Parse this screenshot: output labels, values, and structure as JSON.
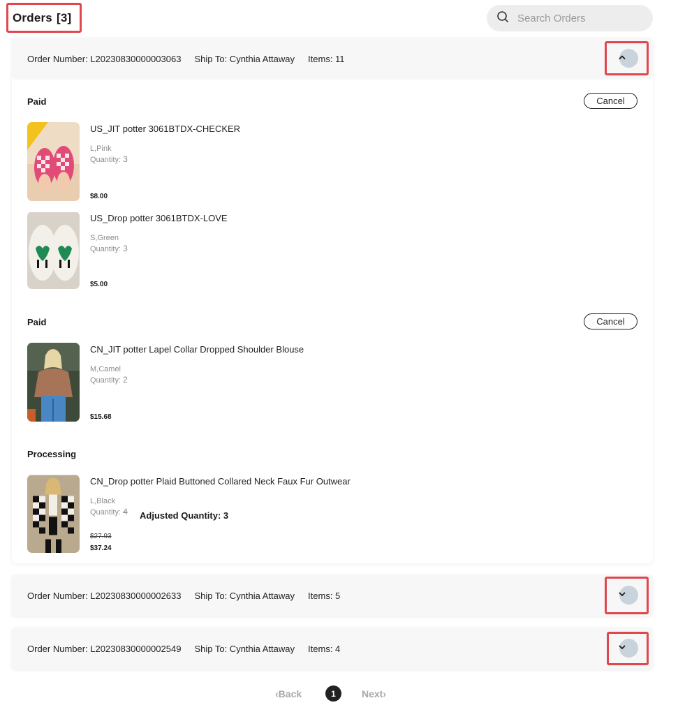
{
  "header": {
    "title": "Orders",
    "count": "[3]"
  },
  "search": {
    "placeholder": "Search Orders"
  },
  "orders": [
    {
      "order_number": "Order Number: L20230830000003063",
      "ship_to": "Ship To: Cynthia Attaway",
      "items_count": "Items: 11",
      "expanded": true,
      "toggle_icon": "chevron-up-icon",
      "groups": [
        {
          "status": "Paid",
          "cancel_label": "Cancel",
          "items": [
            {
              "title": "US_JIT potter 3061BTDX-CHECKER",
              "variant": "L,Pink",
              "qty_label": "Quantity: ",
              "qty": "3",
              "price": "$8.00",
              "image": "pink-checker-slippers"
            },
            {
              "title": "US_Drop potter 3061BTDX-LOVE",
              "variant": "S,Green",
              "qty_label": "Quantity: ",
              "qty": "3",
              "price": "$5.00",
              "image": "green-heart-slippers"
            }
          ]
        },
        {
          "status": "Paid",
          "cancel_label": "Cancel",
          "items": [
            {
              "title": "CN_JIT potter Lapel Collar Dropped Shoulder Blouse",
              "variant": "M,Camel",
              "qty_label": "Quantity: ",
              "qty": "2",
              "price": "$15.68",
              "image": "camel-blouse"
            }
          ]
        },
        {
          "status": "Processing",
          "items": [
            {
              "title": "CN_Drop potter Plaid Buttoned Collared Neck Faux Fur Outwear",
              "variant": "L,Black",
              "qty_label": "Quantity: ",
              "qty": "4",
              "adjusted_qty": "Adjusted Quantity: 3",
              "old_price": "$27.93",
              "price": "$37.24",
              "image": "plaid-faux-fur-coat"
            }
          ]
        }
      ]
    },
    {
      "order_number": "Order Number: L20230830000002633",
      "ship_to": "Ship To: Cynthia Attaway",
      "items_count": "Items: 5",
      "expanded": false,
      "toggle_icon": "chevron-down-icon"
    },
    {
      "order_number": "Order Number: L20230830000002549",
      "ship_to": "Ship To: Cynthia Attaway",
      "items_count": "Items: 4",
      "expanded": false,
      "toggle_icon": "chevron-down-icon"
    }
  ],
  "pagination": {
    "back": "Back",
    "current_page": "1",
    "next": "Next"
  },
  "colors": {
    "highlight": "#e0474c",
    "toggle_bg": "#c9d3dc",
    "header_bg": "#f7f7f7",
    "search_bg": "#ededed"
  }
}
